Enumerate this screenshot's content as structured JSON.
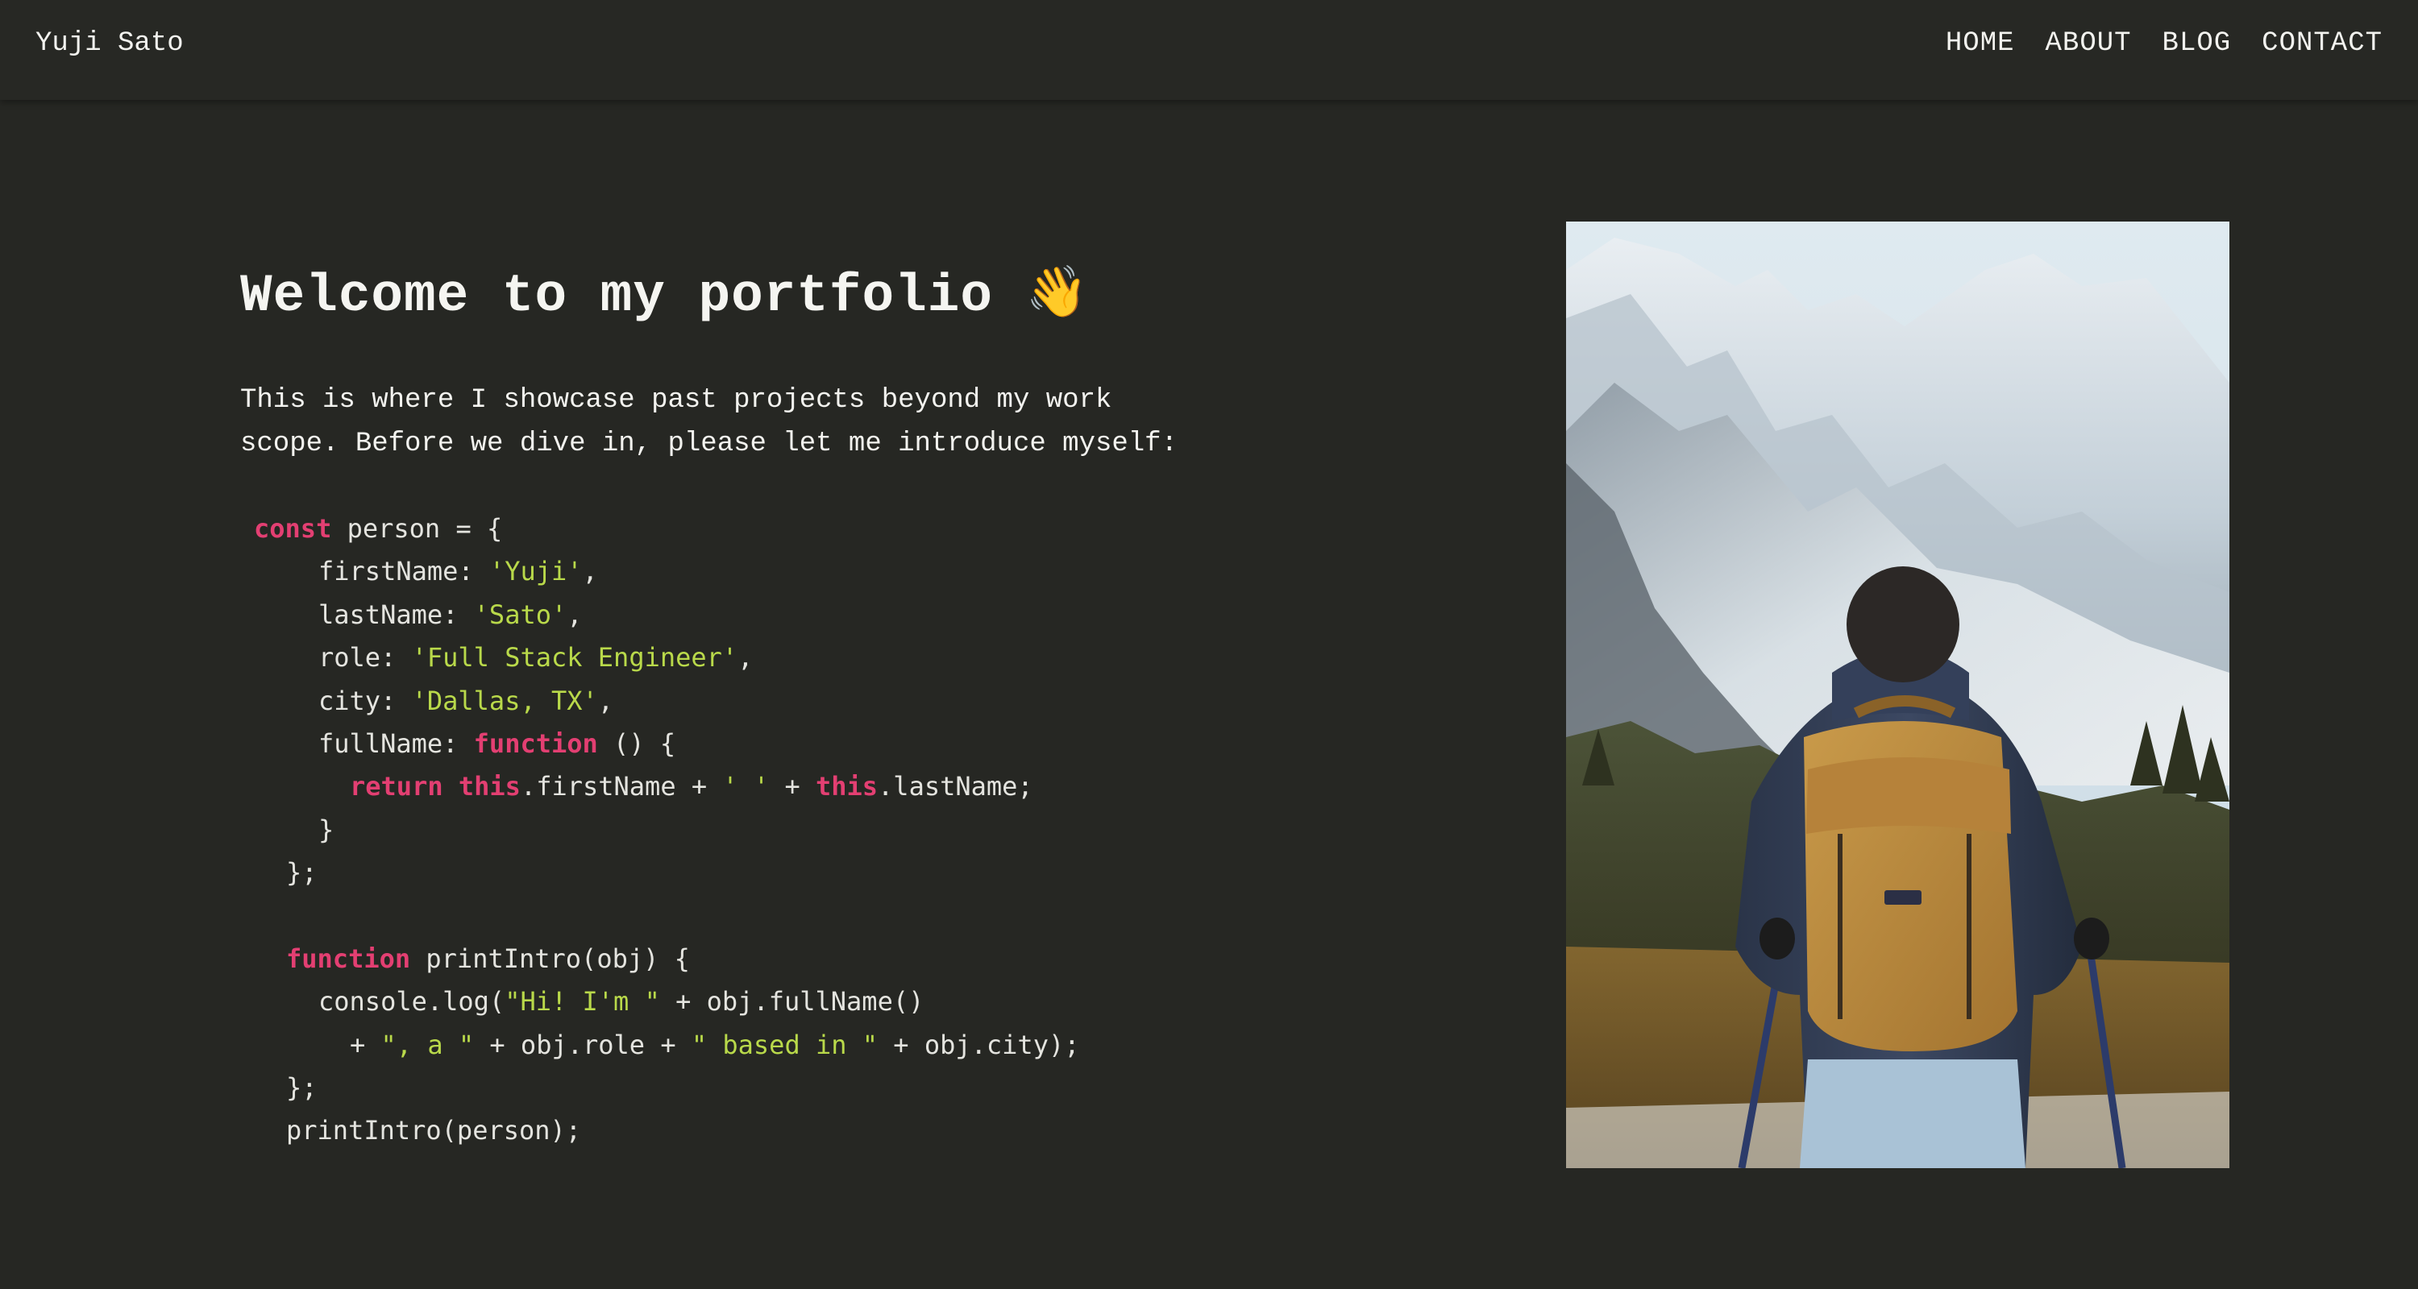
{
  "nav": {
    "brand": "Yuji Sato",
    "links": [
      "HOME",
      "ABOUT",
      "BLOG",
      "CONTACT"
    ]
  },
  "hero": {
    "title": "Welcome to my portfolio",
    "wave_emoji": "👋",
    "intro_line_1": "This is where I showcase past projects beyond my work",
    "intro_line_2": "scope. Before we dive in, please let me introduce myself:"
  },
  "code": {
    "lines": [
      [
        {
          "t": "const",
          "k": "kw"
        },
        {
          "t": " person = {",
          "k": "pl"
        }
      ],
      [
        {
          "t": "firstName: ",
          "k": "pl"
        },
        {
          "t": "'Yuji'",
          "k": "str"
        },
        {
          "t": ",",
          "k": "pl"
        }
      ],
      [
        {
          "t": "lastName: ",
          "k": "pl"
        },
        {
          "t": "'Sato'",
          "k": "str"
        },
        {
          "t": ",",
          "k": "pl"
        }
      ],
      [
        {
          "t": "role: ",
          "k": "pl"
        },
        {
          "t": "'Full Stack Engineer'",
          "k": "str"
        },
        {
          "t": ",",
          "k": "pl"
        }
      ],
      [
        {
          "t": "city: ",
          "k": "pl"
        },
        {
          "t": "'Dallas, TX'",
          "k": "str"
        },
        {
          "t": ",",
          "k": "pl"
        }
      ],
      [
        {
          "t": "fullName: ",
          "k": "pl"
        },
        {
          "t": "function",
          "k": "kw"
        },
        {
          "t": " () {",
          "k": "pl"
        }
      ],
      [
        {
          "t": "return",
          "k": "kw"
        },
        {
          "t": " ",
          "k": "pl"
        },
        {
          "t": "this",
          "k": "kw"
        },
        {
          "t": ".firstName + ",
          "k": "pl"
        },
        {
          "t": "' '",
          "k": "str"
        },
        {
          "t": " + ",
          "k": "pl"
        },
        {
          "t": "this",
          "k": "kw"
        },
        {
          "t": ".lastName;",
          "k": "pl"
        }
      ],
      [
        {
          "t": "}",
          "k": "pl"
        }
      ],
      [
        {
          "t": "};",
          "k": "pl"
        }
      ],
      [],
      [
        {
          "t": "function",
          "k": "kw"
        },
        {
          "t": " printIntro(obj) {",
          "k": "pl"
        }
      ],
      [
        {
          "t": "console.log(",
          "k": "pl"
        },
        {
          "t": "\"Hi! I'm \"",
          "k": "str"
        },
        {
          "t": " + obj.fullName()",
          "k": "pl"
        }
      ],
      [
        {
          "t": "+ ",
          "k": "pl"
        },
        {
          "t": "\", a \"",
          "k": "str"
        },
        {
          "t": " + obj.role + ",
          "k": "pl"
        },
        {
          "t": "\" based in \"",
          "k": "str"
        },
        {
          "t": " + obj.city);",
          "k": "pl"
        }
      ],
      [
        {
          "t": "};",
          "k": "pl"
        }
      ],
      [
        {
          "t": "printIntro(person);",
          "k": "pl"
        }
      ]
    ]
  },
  "photo": {
    "subject": "hiker-with-backpack-facing-snowy-mountains"
  }
}
